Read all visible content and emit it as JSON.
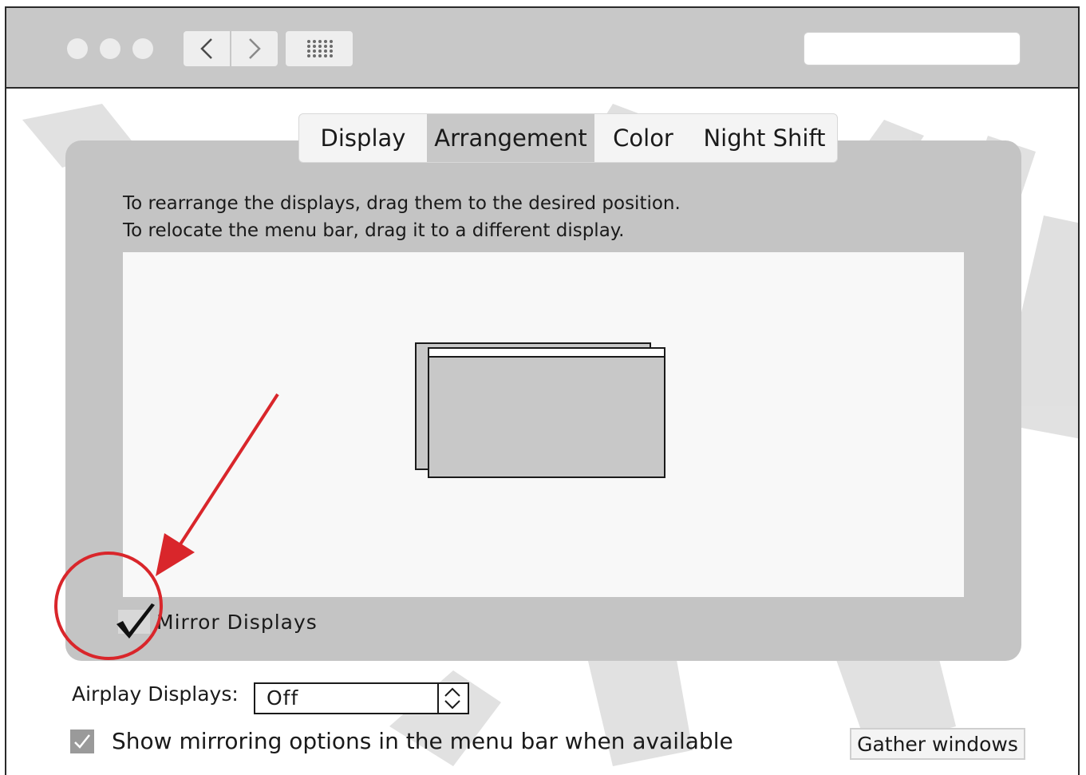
{
  "window": {
    "nav_back_icon": "chevron-left-icon",
    "nav_forward_icon": "chevron-right-icon",
    "grid_icon": "grid-icon",
    "search_placeholder": ""
  },
  "tabs": [
    {
      "label": "Display",
      "selected": false
    },
    {
      "label": "Arrangement",
      "selected": true
    },
    {
      "label": "Color",
      "selected": false
    },
    {
      "label": "Night Shift",
      "selected": false
    }
  ],
  "arrangement": {
    "instruction_line_1": "To rearrange the displays, drag them to the desired position.",
    "instruction_line_2": "To relocate the menu bar, drag it to a different display.",
    "mirror_label": "Mirror Displays",
    "mirror_checked": true
  },
  "airplay": {
    "label": "Airplay Displays:",
    "value": "Off"
  },
  "show_mirroring": {
    "label": "Show mirroring options in the menu bar when available",
    "checked": true
  },
  "gather_button": "Gather windows",
  "colors": {
    "annotation": "#d9262b",
    "panel": "#c4c4c4",
    "titlebar": "#c8c8c8"
  }
}
